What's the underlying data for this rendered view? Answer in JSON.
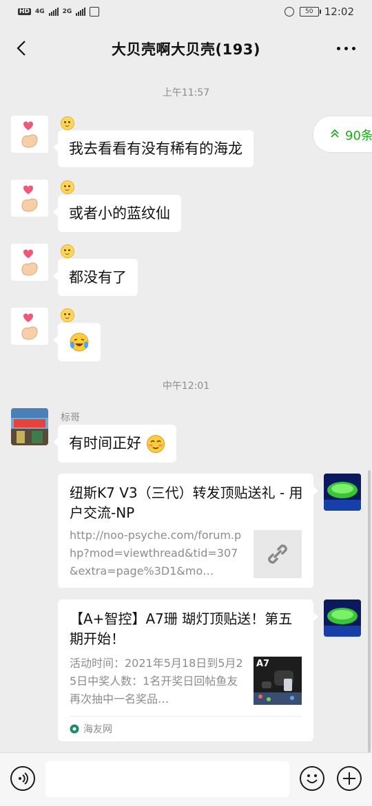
{
  "status_bar": {
    "hd_label": "HD",
    "net1": "4G",
    "net2": "2G",
    "battery": "50",
    "time": "12:02"
  },
  "header": {
    "title": "大贝壳啊大贝壳(193)"
  },
  "unread": {
    "label": "90条"
  },
  "timestamps": [
    "上午11:57",
    "中午12:01"
  ],
  "messages": [
    {
      "text": "我去看看有没有稀有的海龙"
    },
    {
      "text": "或者小的蓝纹仙"
    },
    {
      "text": "都没有了"
    },
    {
      "text": ""
    }
  ],
  "message5": {
    "sender": "标哥",
    "text": "有时间正好"
  },
  "cards": [
    {
      "title": "纽斯K7 V3（三代）转发顶贴送礼 - 用户交流-NP",
      "desc": "http://noo-psyche.com/forum.php?mod=viewthread&tid=307&extra=page%3D1&mo…",
      "thumb_icon": "link-icon"
    },
    {
      "title": "【A+智控】A7珊 瑚灯顶贴送！第五期开始！",
      "desc": "活动时间：2021年5月18日到5月25日中奖人数：1名开奖日回帖鱼友再次抽中一名奖品…",
      "thumb_label": "A7",
      "source": "海友网"
    }
  ],
  "colors": {
    "accent": "#1aad19",
    "bubble": "#ffffff",
    "background": "#ededed"
  }
}
